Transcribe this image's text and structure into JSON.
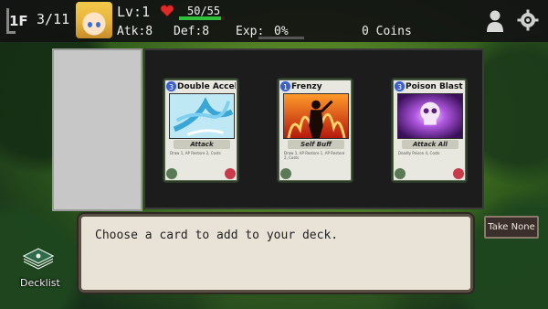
{
  "hud": {
    "floor_label": "1F",
    "floor_progress": "3/11",
    "level": "Lv:1",
    "hp_text": "50/55",
    "hp_fraction": 0.91,
    "attack": "Atk:8",
    "defense": "Def:8",
    "exp_label": "Exp:",
    "exp_value": "0%",
    "exp_fraction": 0.0,
    "coins": "0 Coins"
  },
  "cards": [
    {
      "cost": "3",
      "name": "Double Accel",
      "type": "Attack",
      "desc": "Draw 1, AP Restore 2, Costs",
      "art": "blue-wind-art",
      "color": "#8fd6f0"
    },
    {
      "cost": "1",
      "name": "Frenzy",
      "type": "Self Buff",
      "desc": "Draw 1, AP Restore 1, AP Restore 2, Costs",
      "art": "red-flame-figure-art",
      "color": "#e8501c"
    },
    {
      "cost": "3",
      "name": "Poison Blast",
      "type": "Attack All",
      "desc": "Deadly Poison 4, Costs",
      "art": "purple-skull-art",
      "color": "#a24bd8"
    }
  ],
  "dialogue": {
    "message": "Choose a card to add to your deck."
  },
  "buttons": {
    "take_none": "Take None",
    "decklist": "Decklist"
  },
  "colors": {
    "hp_bar": "#2fbf3a",
    "card_cost": "#3b5fc7",
    "panel_bg": "#1c1c1c"
  }
}
